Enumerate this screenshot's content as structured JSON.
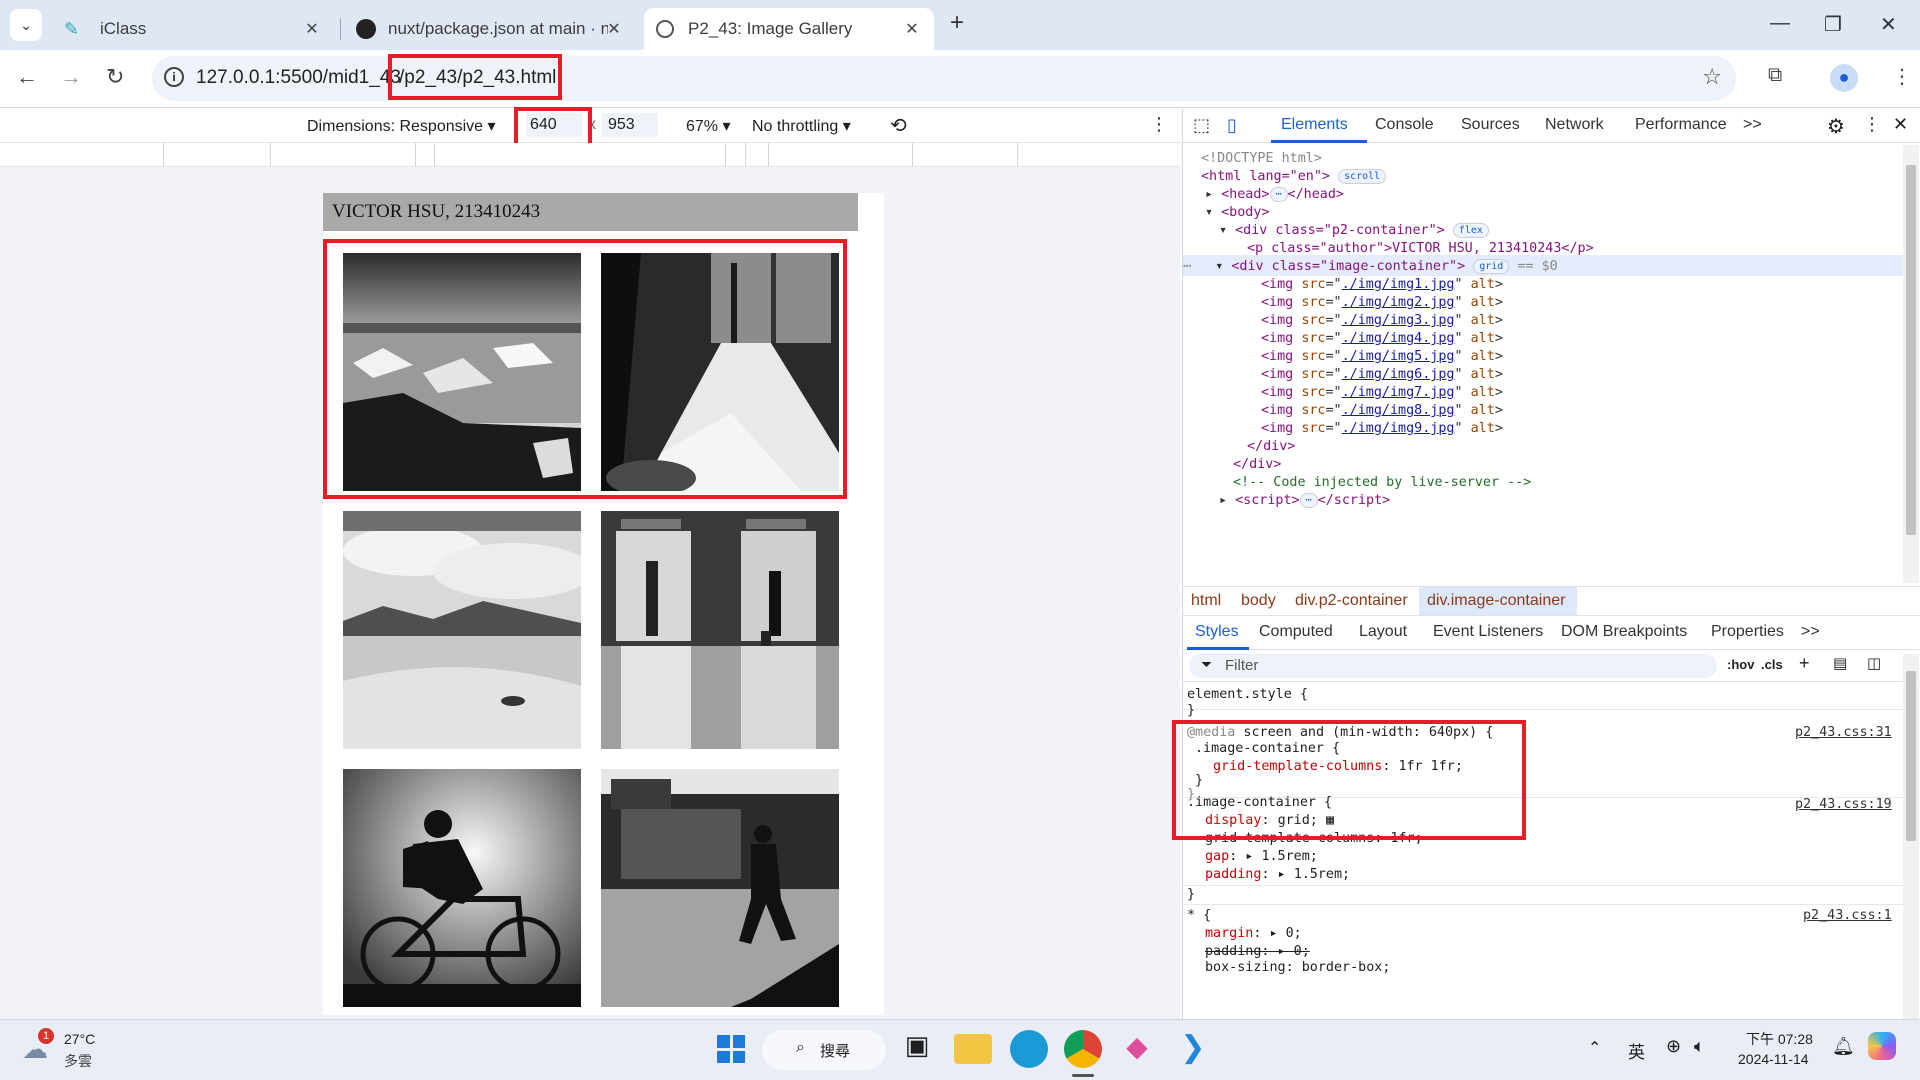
{
  "browser": {
    "tabs": [
      {
        "title": "iClass",
        "icon": "iclass-icon"
      },
      {
        "title": "nuxt/package.json at main · n",
        "icon": "github-icon"
      },
      {
        "title": "P2_43: Image Gallery",
        "icon": "globe-icon",
        "active": true
      }
    ],
    "new_tab": "+",
    "url": {
      "prefix": "127.0.0.1:5500/mid1_43",
      "highlighted": "/p2_43/p2_43.html"
    }
  },
  "device_toolbar": {
    "dimensions": "Dimensions: Responsive",
    "width": "640",
    "times": "x",
    "height": "953",
    "zoom": "67%",
    "throttling": "No throttling"
  },
  "page": {
    "author": "VICTOR HSU, 213410243",
    "images": [
      "img1",
      "img2",
      "img3",
      "img4",
      "img5",
      "img6"
    ]
  },
  "devtools": {
    "tabs": [
      "Elements",
      "Console",
      "Sources",
      "Network",
      "Performance"
    ],
    "more": ">>",
    "dom": {
      "doctype": "<!DOCTYPE html>",
      "html_open": "<html lang=\"en\">",
      "scroll_badge": "scroll",
      "head": "<head>",
      "head_close": "</head>",
      "body": "<body>",
      "p2_container": "<div class=\"p2-container\">",
      "flex_badge": "flex",
      "author_line": "<p class=\"author\">VICTOR HSU, 213410243</p>",
      "image_container": "<div class=\"image-container\">",
      "grid_badge": "grid",
      "selected_marker": "== $0",
      "images": [
        "./img/img1.jpg",
        "./img/img2.jpg",
        "./img/img3.jpg",
        "./img/img4.jpg",
        "./img/img5.jpg",
        "./img/img6.jpg",
        "./img/img7.jpg",
        "./img/img8.jpg",
        "./img/img9.jpg"
      ],
      "div_close": "</div>",
      "comment": "<!-- Code injected by live-server -->",
      "script": "<script>"
    },
    "breadcrumbs": [
      "html",
      "body",
      "div.p2-container",
      "div.image-container"
    ],
    "styles_tabs": [
      "Styles",
      "Computed",
      "Layout",
      "Event Listeners",
      "DOM Breakpoints",
      "Properties"
    ],
    "filter_placeholder": "Filter",
    "hov": ":hov",
    "cls": ".cls",
    "styles": {
      "element_style": "element.style {",
      "close_brace": "}",
      "media_at": "@media",
      "media_query": " screen and (min-width: 640px) {",
      "media_selector": ".image-container {",
      "media_prop": "grid-template-columns",
      "media_val": "1fr 1fr;",
      "media_src": "p2_43.css:31",
      "rule2_selector": ".image-container {",
      "rule2_src": "p2_43.css:19",
      "display_prop": "display",
      "display_val": "grid;",
      "gtc_struck": "grid-template-columns: 1fr;",
      "gap_prop": "gap",
      "gap_val": "1.5rem;",
      "padding_prop": "padding",
      "padding_val": "1.5rem;",
      "rule3_selector": "* {",
      "rule3_src": "p2_43.css:1",
      "margin_prop": "margin",
      "margin_val": "0;",
      "padding_struck": "padding: ▸ 0;",
      "boxsizing": "box-sizing: border-box;"
    }
  },
  "taskbar": {
    "weather": {
      "temp": "27°C",
      "desc": "多雲",
      "badge": "1"
    },
    "search": "搜尋",
    "ime": "英",
    "time": "下午 07:28",
    "date": "2024-11-14"
  },
  "colors": {
    "annotation": "#e31e24",
    "devtools_accent": "#1a5fd6"
  }
}
